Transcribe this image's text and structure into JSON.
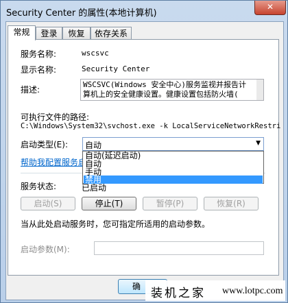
{
  "window": {
    "title": "Security Center 的属性(本地计算机)",
    "close_label": "✕"
  },
  "tabs": [
    "常规",
    "登录",
    "恢复",
    "依存关系"
  ],
  "general": {
    "service_name_label": "服务名称:",
    "service_name": "wscsvc",
    "display_name_label": "显示名称:",
    "display_name": "Security Center",
    "description_label": "描述:",
    "description_line1": "WSCSVC(Windows 安全中心)服务监视并报告计",
    "description_line2": "算机上的安全健康设置。健康设置包括防火墙(",
    "path_label": "可执行文件的路径:",
    "path": "C:\\Windows\\System32\\svchost.exe -k LocalServiceNetworkRestri",
    "startup_type_label": "启动类型(E):",
    "startup_type_value": "自动",
    "startup_options": [
      "自动(延迟启动)",
      "自动",
      "手动",
      "禁用"
    ],
    "selected_option_index": 3,
    "help_link": "帮助我配置服务启",
    "status_label": "服务状态:",
    "status_value": "已启动",
    "buttons": {
      "start": "启动(S)",
      "stop": "停止(T)",
      "pause": "暂停(P)",
      "resume": "恢复(R)"
    },
    "hint": "当从此处启动服务时，您可指定所适用的启动参数。",
    "start_params_label": "启动参数(M):",
    "start_params_value": ""
  },
  "footer": {
    "ok_label": "确"
  },
  "watermark": {
    "text": "装机之家",
    "url": "www.lotpc.com"
  }
}
